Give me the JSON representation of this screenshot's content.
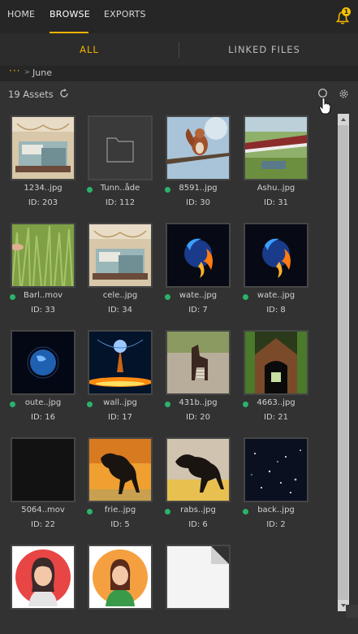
{
  "nav": {
    "tabs": [
      {
        "label": "HOME"
      },
      {
        "label": "BROWSE"
      },
      {
        "label": "EXPORTS"
      }
    ],
    "active_tab": "BROWSE",
    "notifications": {
      "count": "1",
      "icon": "bell-icon"
    }
  },
  "subtabs": {
    "all": "ALL",
    "linked": "LINKED FILES",
    "active": "ALL"
  },
  "breadcrumb": {
    "dots": "···",
    "separator": ">",
    "folder": "June"
  },
  "toolbar": {
    "assets_count": "19 Assets",
    "refresh_icon": "refresh-icon",
    "search_icon": "search-icon",
    "settings_icon": "gear-icon"
  },
  "colors": {
    "accent": "#f0b400",
    "status_green": "#2bb36b",
    "background": "#323232",
    "topbar": "#262626"
  },
  "assets": [
    {
      "name": "1234..jpg",
      "id": "ID: 203",
      "status": false,
      "thumb": "bedroom"
    },
    {
      "name": "Tunn..åde",
      "id": "ID: 112",
      "status": true,
      "thumb": "folder"
    },
    {
      "name": "8591..jpg",
      "id": "ID: 30",
      "status": true,
      "thumb": "squirrel"
    },
    {
      "name": "Ashu..jpg",
      "id": "ID: 31",
      "status": false,
      "thumb": "bridge"
    },
    {
      "name": "Barl..mov",
      "id": "ID: 33",
      "status": true,
      "thumb": "grass"
    },
    {
      "name": "cele..jpg",
      "id": "ID: 34",
      "status": false,
      "thumb": "bedroom"
    },
    {
      "name": "wate..jpg",
      "id": "ID: 7",
      "status": true,
      "thumb": "fireplanet"
    },
    {
      "name": "wate..jpg",
      "id": "ID: 8",
      "status": true,
      "thumb": "fireplanet"
    },
    {
      "name": "oute..jpg",
      "id": "ID: 16",
      "status": true,
      "thumb": "earth"
    },
    {
      "name": "wall..jpg",
      "id": "ID: 17",
      "status": true,
      "thumb": "galaxy"
    },
    {
      "name": "431b..jpg",
      "id": "ID: 20",
      "status": true,
      "thumb": "okapi"
    },
    {
      "name": "4663..jpg",
      "id": "ID: 21",
      "status": true,
      "thumb": "tunnel"
    },
    {
      "name": "5064..mov",
      "id": "ID: 22",
      "status": false,
      "thumb": "dark"
    },
    {
      "name": "frie..jpg",
      "id": "ID: 5",
      "status": true,
      "thumb": "horse"
    },
    {
      "name": "rabs..jpg",
      "id": "ID: 6",
      "status": true,
      "thumb": "horse2"
    },
    {
      "name": "back..jpg",
      "id": "ID: 2",
      "status": true,
      "thumb": "stars"
    },
    {
      "name": "",
      "id": "",
      "status": false,
      "thumb": "avatar-red"
    },
    {
      "name": "",
      "id": "",
      "status": false,
      "thumb": "avatar-orange"
    },
    {
      "name": "",
      "id": "",
      "status": false,
      "thumb": "document"
    }
  ]
}
